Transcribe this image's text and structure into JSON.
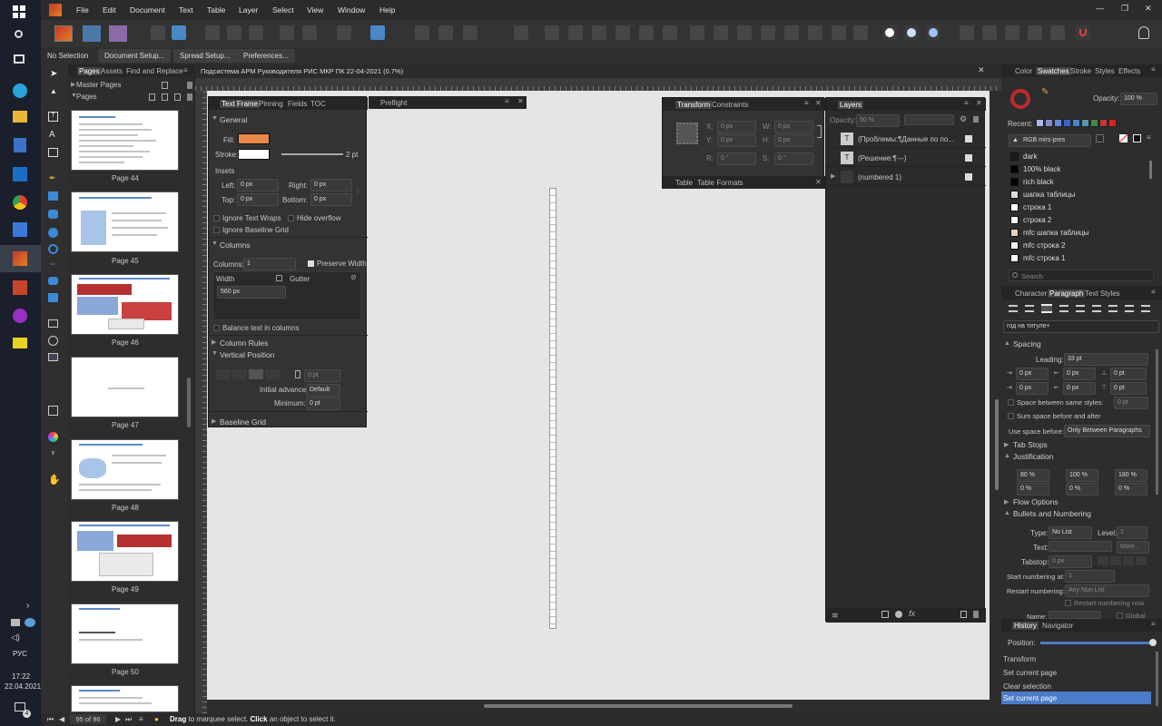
{
  "menubar": {
    "items": [
      "File",
      "Edit",
      "Document",
      "Text",
      "Table",
      "Layer",
      "Select",
      "View",
      "Window",
      "Help"
    ],
    "window_controls": [
      "—",
      "❐",
      "✕"
    ]
  },
  "context_toolbar": {
    "no_selection": "No Selection",
    "document_setup": "Document Setup...",
    "spread_setup": "Spread Setup...",
    "preferences": "Preferences..."
  },
  "pages_panel": {
    "tabs": [
      "Pages",
      "Assets",
      "Find and Replace"
    ],
    "master_pages": "Master Pages",
    "pages": "Pages",
    "thumbs": [
      "Page 44",
      "Page 45",
      "Page 46",
      "Page 47",
      "Page 48",
      "Page 49",
      "Page 50"
    ]
  },
  "document": {
    "title": "Подсистема АРМ Руководителя РИС МКР ПК 22-04-2021 (0.7%)"
  },
  "text_frame_panel": {
    "tabs": [
      "Text Frame",
      "Pinning",
      "Fields",
      "TOC"
    ],
    "preflight_tab": "Preflight",
    "general": "General",
    "fill": "Fill:",
    "stroke": "Stroke:",
    "stroke_width": "2 pt",
    "insets": "Insets",
    "left": "Left:",
    "right": "Right:",
    "top": "Top:",
    "bottom": "Bottom:",
    "left_val": "0 px",
    "right_val": "0 px",
    "top_val": "0 px",
    "bottom_val": "0 px",
    "ignore_text_wraps": "Ignore Text Wraps",
    "hide_overflow": "Hide overflow",
    "ignore_baseline": "Ignore Baseline Grid",
    "columns_section": "Columns",
    "columns_label": "Columns:",
    "columns_val": "1",
    "preserve_width": "Preserve Width",
    "width_header": "Width",
    "gutter_header": "Gutter",
    "width_val": "560 px",
    "balance_text": "Balance text in columns",
    "column_rules": "Column Rules",
    "vertical_position": "Vertical Position",
    "vpos_val": "0 pt",
    "initial_advance": "Initial advance:",
    "initial_advance_val": "Default",
    "minimum": "Minimum:",
    "minimum_val": "0 pt",
    "baseline_grid": "Baseline Grid",
    "fill_color": "#e8894a",
    "stroke_color": "#ffffff"
  },
  "transform_panel": {
    "tabs": [
      "Transform",
      "Constraints"
    ],
    "x": "X:",
    "y": "Y:",
    "w": "W:",
    "h": "H:",
    "r": "R:",
    "s": "S:",
    "x_val": "0 px",
    "y_val": "0 px",
    "w_val": "0 px",
    "h_val": "0 px",
    "r_val": "0 °",
    "s_val": "0 °",
    "bottom_tabs": [
      "Table",
      "Table Formats"
    ]
  },
  "layers_panel": {
    "tab": "Layers",
    "opacity_label": "Opacity:",
    "opacity_val": "50 %",
    "layers": [
      "(Проблемы:¶Данные по по...",
      "(Решение:¶---)",
      "(numbered 1)"
    ]
  },
  "right_top": {
    "tabs": [
      "Color",
      "Swatches",
      "Stroke",
      "Styles",
      "Effects"
    ],
    "opacity_label": "Opacity:",
    "opacity_val": "100 %",
    "recent": "Recent:",
    "palette": "RGB mirs-pres",
    "recent_colors": [
      "#a8b8e8",
      "#8888cc",
      "#6688dd",
      "#3366cc",
      "#4488cc",
      "#5599aa",
      "#448844",
      "#cc3333",
      "#dd2222"
    ],
    "swatches": [
      {
        "name": "dark",
        "color": "#1e1e1e"
      },
      {
        "name": "100% black",
        "color": "#000000"
      },
      {
        "name": "rich black",
        "color": "#050505"
      },
      {
        "name": "шапка таблицы",
        "color": "#dcdcdc"
      },
      {
        "name": "строка 1",
        "color": "#ffffff"
      },
      {
        "name": "строка 2",
        "color": "#f5f5f5"
      },
      {
        "name": "mfc шапка таблицы",
        "color": "#e8d0c0"
      },
      {
        "name": "mfc строка 2",
        "color": "#fbf1ea"
      },
      {
        "name": "mfc строка 1",
        "color": "#ffffff"
      }
    ],
    "search": "Search"
  },
  "paragraph_panel": {
    "tabs": [
      "Character",
      "Paragraph",
      "Text Styles"
    ],
    "style": "год на титуле+",
    "spacing": "Spacing",
    "leading_label": "Leading:",
    "leading_val": "33 pt",
    "zero_pt": "0 pt",
    "zero_px": "0 px",
    "space_between": "Space between same styles:",
    "sum_space": "Sum space before and after",
    "use_space_before": "Use space before:",
    "use_space_before_val": "Only Between Paragraphs",
    "tab_stops": "Tab Stops",
    "justification": "Justification",
    "j1": "80 %",
    "j2": "100 %",
    "j3": "180 %",
    "j4": "0 %",
    "j5": "0 %",
    "j6": "0 %",
    "flow_options": "Flow Options",
    "bullets": "Bullets and Numbering",
    "type_label": "Type:",
    "type_val": "No List",
    "level_label": "Level:",
    "level_val": "1",
    "text_label": "Text:",
    "more": "More...",
    "tabstop_label": "Tabstop:",
    "tabstop_val": "0 px",
    "start_numbering": "Start numbering at:",
    "start_val": "1",
    "restart_numbering": "Restart numbering:",
    "restart_val": "Any Non List",
    "restart_now": "Restart numbering now",
    "name_label": "Name:",
    "global": "Global"
  },
  "history_panel": {
    "tabs": [
      "History",
      "Navigator"
    ],
    "position": "Position:",
    "items": [
      "Transform",
      "Set current page",
      "Clear selection",
      "Set current page"
    ]
  },
  "statusbar": {
    "page_counter": "95 of 96",
    "hint_bold1": "Drag",
    "hint_1": " to marquee select. ",
    "hint_bold2": "Click",
    "hint_2": " an object to select it."
  },
  "taskbar": {
    "lang": "РУС",
    "time": "17:22",
    "date": "22.04.2021",
    "notif": "4"
  }
}
